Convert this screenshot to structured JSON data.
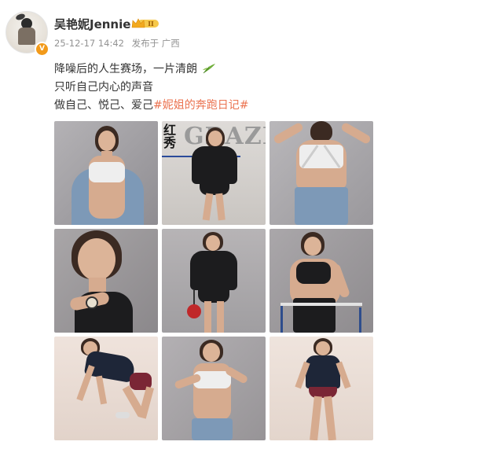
{
  "user": {
    "name": "吴艳妮Jennie",
    "verified_icon": "verified-v-icon",
    "member_badge_icon": "crown-badge-icon",
    "member_badge_level": "II"
  },
  "meta": {
    "time": "25-12-17 14:42",
    "source": "发布于 广西"
  },
  "content": {
    "line1": "降噪后的人生赛场，一片清朗",
    "line1_emoji": "bamboo-leaf-icon",
    "line2": "只听自己内心的声音",
    "line3_prefix": "做自己、悦己、爱己",
    "hashtag": "#妮姐的奔跑日记#"
  },
  "photos": [
    {
      "index": 1,
      "icon": "photo-grey-backdrop-white-top-denim-jacket"
    },
    {
      "index": 2,
      "icon": "photo-magazine-cover-leather-jacket",
      "magazine_text_1": "红秀",
      "magazine_text_2": "GRAZIA"
    },
    {
      "index": 3,
      "icon": "photo-back-view-white-sports-bra"
    },
    {
      "index": 4,
      "icon": "photo-closeup-black-halter"
    },
    {
      "index": 5,
      "icon": "photo-leather-jacket-boxing-glove"
    },
    {
      "index": 6,
      "icon": "photo-black-halter-hurdles"
    },
    {
      "index": 7,
      "icon": "photo-crouching-start-navy-polo"
    },
    {
      "index": 8,
      "icon": "photo-white-top-jeans"
    },
    {
      "index": 9,
      "icon": "photo-standing-navy-polo"
    }
  ],
  "colors": {
    "hashtag": "#eb7350",
    "text": "#333333",
    "meta": "#939393",
    "badge": "#f29a1a"
  }
}
